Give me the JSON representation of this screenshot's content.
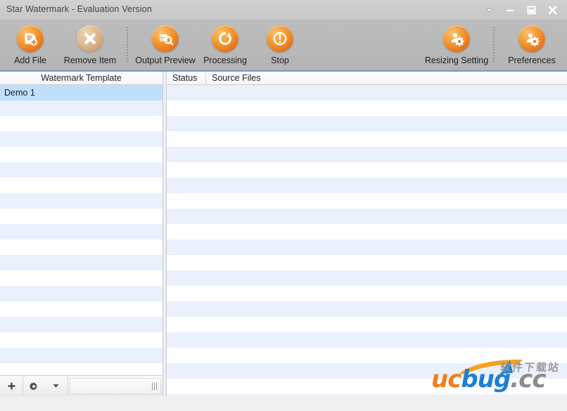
{
  "window": {
    "title": "Star Watermark - Evaluation Version",
    "controls": [
      {
        "name": "dropdown-arrow",
        "label": "▾"
      },
      {
        "name": "minimize",
        "label": "—"
      },
      {
        "name": "maximize",
        "label": "▢"
      },
      {
        "name": "close",
        "label": "✕"
      }
    ]
  },
  "toolbar": {
    "left_items": [
      {
        "label": "Add File",
        "icon": "add-file-icon",
        "enabled": true
      },
      {
        "label": "Remove Item",
        "icon": "remove-item-icon",
        "enabled": false
      },
      {
        "label": "Output Preview",
        "icon": "output-preview-icon",
        "enabled": true
      },
      {
        "label": "Processing",
        "icon": "processing-icon",
        "enabled": true
      },
      {
        "label": "Stop",
        "icon": "stop-icon",
        "enabled": true
      }
    ],
    "right_items": [
      {
        "label": "Resizing Setting",
        "icon": "resizing-setting-icon",
        "enabled": true
      },
      {
        "label": "Preferences",
        "icon": "preferences-icon",
        "enabled": true
      }
    ]
  },
  "left_pane": {
    "header": "Watermark Template",
    "items": [
      {
        "label": "Demo 1",
        "selected": true
      }
    ],
    "total_rows": 20,
    "bottom_bar": {
      "add_label": "+",
      "gear_label": "gear-icon",
      "caret_label": "▾"
    }
  },
  "right_pane": {
    "columns": [
      {
        "key": "status",
        "label": "Status"
      },
      {
        "key": "source",
        "label": "Source Files"
      }
    ],
    "rows": [],
    "total_rows": 21
  },
  "watermark": {
    "chinese": "软件下载站",
    "brand_uc": "uc",
    "brand_bug": "bug",
    "brand_tld": ".cc"
  },
  "colors": {
    "title_bar": "#cdcdcd",
    "toolbar": "#b9b9b9",
    "accent_blue": "#6f9dd0",
    "row_alt": "#eaf0fc",
    "row_selected": "#bfe0fb",
    "icon_orange": "#e8731a"
  }
}
